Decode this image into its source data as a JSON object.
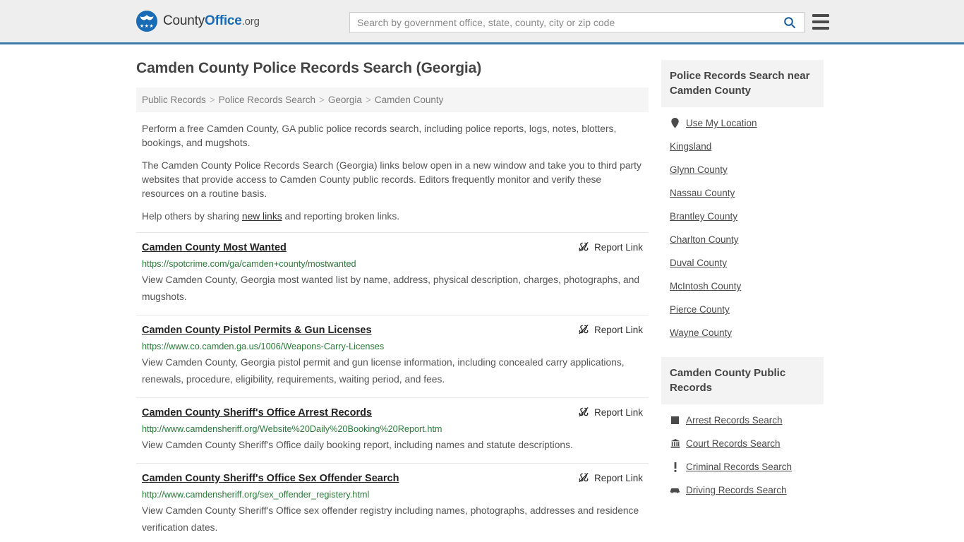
{
  "header": {
    "logo": {
      "part1": "County",
      "part2": "Office",
      "suffix": ".org",
      "icon": "eagle-seal-icon"
    },
    "search": {
      "placeholder": "Search by government office, state, county, city or zip code",
      "value": "",
      "button_icon": "search-icon"
    },
    "menu_icon": "hamburger-menu-icon",
    "accent_color": "#3d7ca8"
  },
  "page_title": "Camden County Police Records Search (Georgia)",
  "breadcrumb": {
    "separator": ">",
    "items": [
      "Public Records",
      "Police Records Search",
      "Georgia",
      "Camden County"
    ]
  },
  "intro": {
    "paragraph1": "Perform a free Camden County, GA public police records search, including police reports, logs, notes, blotters, bookings, and mugshots.",
    "paragraph2": "The Camden County Police Records Search (Georgia) links below open in a new window and take you to third party websites that provide access to Camden County public records. Editors frequently monitor and verify these resources on a routine basis.",
    "paragraph3_before": "Help others by sharing ",
    "paragraph3_link": "new links",
    "paragraph3_after": " and reporting broken links."
  },
  "report_link_label": "Report Link",
  "report_link_icon": "broken-link-icon",
  "results": [
    {
      "title": "Camden County Most Wanted",
      "url": "https://spotcrime.com/ga/camden+county/mostwanted",
      "description": "View Camden County, Georgia most wanted list by name, address, physical description, charges, photographs, and mugshots."
    },
    {
      "title": "Camden County Pistol Permits & Gun Licenses",
      "url": "https://www.co.camden.ga.us/1006/Weapons-Carry-Licenses",
      "description": "View Camden County, Georgia pistol permit and gun license information, including concealed carry applications, renewals, procedure, eligibility, requirements, waiting period, and fees."
    },
    {
      "title": "Camden County Sheriff's Office Arrest Records",
      "url": "http://www.camdensheriff.org/Website%20Daily%20Booking%20Report.htm",
      "description": "View Camden County Sheriff's Office daily booking report, including names and statute descriptions."
    },
    {
      "title": "Camden County Sheriff's Office Sex Offender Search",
      "url": "http://www.camdensheriff.org/sex_offender_registery.html",
      "description": "View Camden County Sheriff's Office sex offender registry including names, photographs, addresses and residence verification dates."
    }
  ],
  "sidebar": {
    "nearby": {
      "heading": "Police Records Search near Camden County",
      "items": [
        {
          "label": "Use My Location",
          "icon": "map-pin-icon"
        },
        {
          "label": "Kingsland",
          "icon": null
        },
        {
          "label": "Glynn County",
          "icon": null
        },
        {
          "label": "Nassau County",
          "icon": null
        },
        {
          "label": "Brantley County",
          "icon": null
        },
        {
          "label": "Charlton County",
          "icon": null
        },
        {
          "label": "Duval County",
          "icon": null
        },
        {
          "label": "McIntosh County",
          "icon": null
        },
        {
          "label": "Pierce County",
          "icon": null
        },
        {
          "label": "Wayne County",
          "icon": null
        }
      ]
    },
    "public_records": {
      "heading": "Camden County Public Records",
      "items": [
        {
          "label": "Arrest Records Search",
          "icon": "square-icon"
        },
        {
          "label": "Court Records Search",
          "icon": "courthouse-icon"
        },
        {
          "label": "Criminal Records Search",
          "icon": "exclamation-icon"
        },
        {
          "label": "Driving Records Search",
          "icon": "car-icon"
        }
      ]
    }
  }
}
